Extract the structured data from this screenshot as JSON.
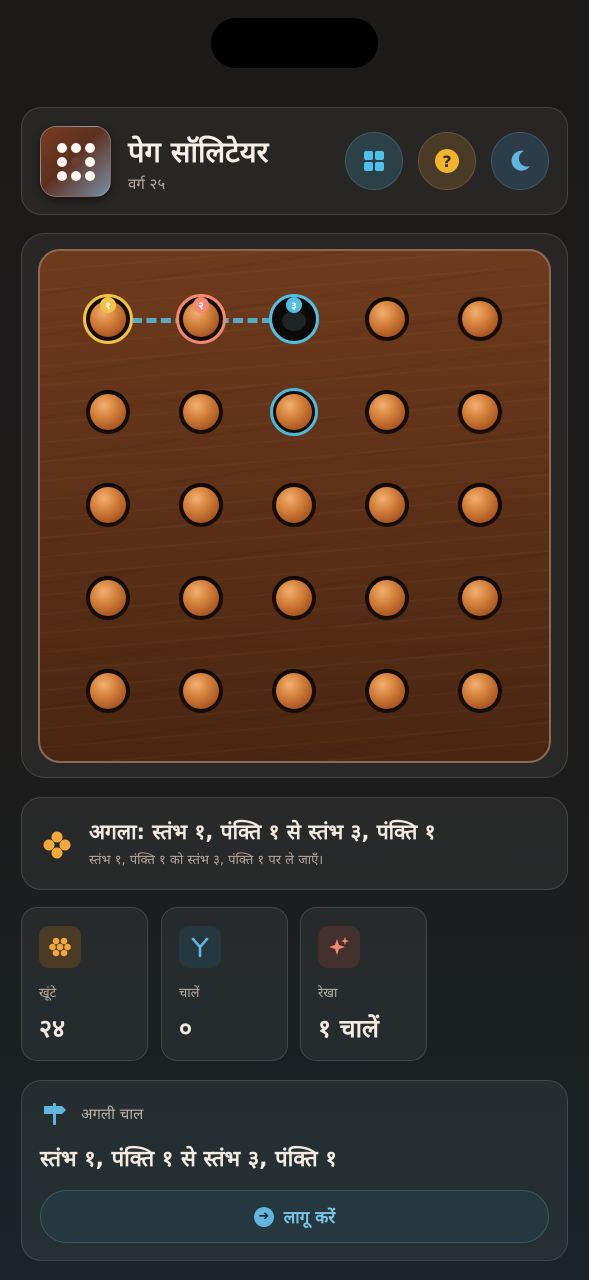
{
  "header": {
    "title": "पेग सॉलिटेयर",
    "subtitle": "वर्ग २५",
    "buttons": {
      "grid_icon": "grid-icon",
      "help_icon": "help-icon",
      "help_glyph": "?",
      "moon_icon": "moon-icon"
    }
  },
  "board": {
    "rows": 5,
    "cols": 5,
    "peg_color": "#c8733a",
    "empty_hole": {
      "row": 1,
      "col": 3
    },
    "selected_path": [
      {
        "row": 1,
        "col": 1,
        "badge": "१",
        "color": "#f1c24a"
      },
      {
        "row": 1,
        "col": 2,
        "badge": "२",
        "color": "#f08a72"
      },
      {
        "row": 1,
        "col": 3,
        "badge": "३",
        "color": "#52bfe0"
      }
    ],
    "highlight": {
      "row": 2,
      "col": 3,
      "color": "#4fb8d6"
    }
  },
  "next": {
    "title": "अगला: स्तंभ १, पंक्ति १ से स्तंभ ३, पंक्ति १",
    "description": "स्तंभ १, पंक्ति १ को स्तंभ ३, पंक्ति १ पर ले जाएँ।"
  },
  "stats": [
    {
      "label": "खूंटे",
      "value": "२४",
      "icon": "pegs-icon",
      "color": "#f2a93b"
    },
    {
      "label": "चालें",
      "value": "०",
      "icon": "fork-icon",
      "color": "#62b6de"
    },
    {
      "label": "रेखा",
      "value": "१ चालें",
      "icon": "sparkle-icon",
      "color": "#f08a72"
    }
  ],
  "hint": {
    "label": "अगली चाल",
    "move": "स्तंभ १, पंक्ति १ से स्तंभ ३, पंक्ति १",
    "apply_label": "लागू करें"
  }
}
